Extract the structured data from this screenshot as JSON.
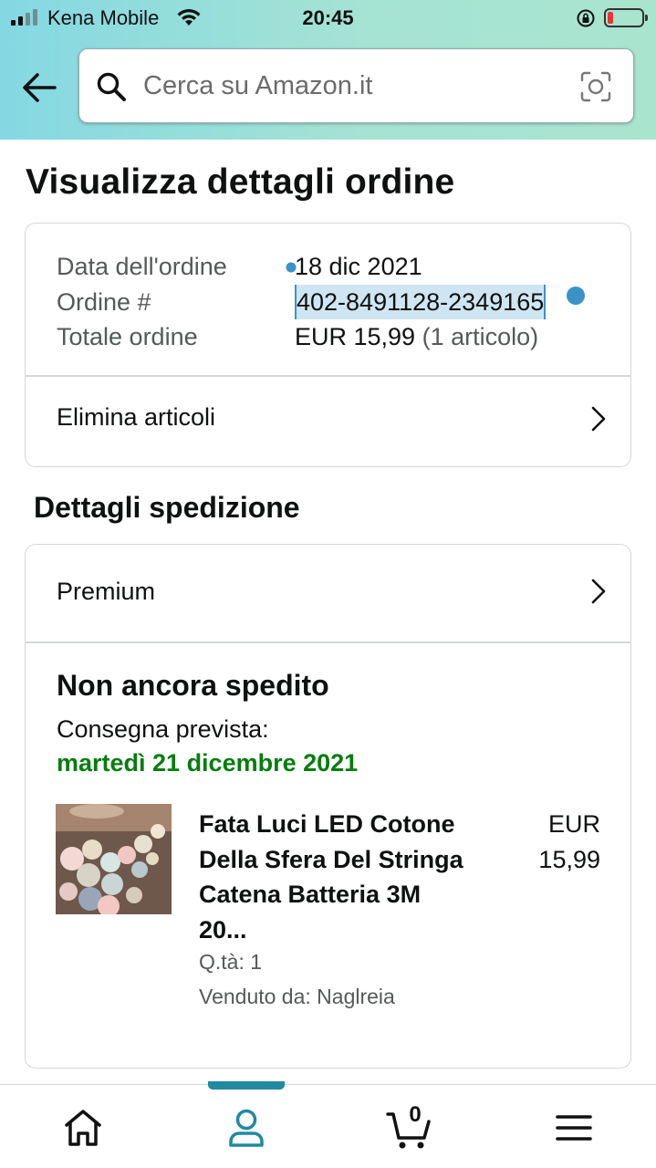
{
  "status_bar": {
    "carrier": "Kena Mobile",
    "time": "20:45",
    "battery_color": "#ee3333"
  },
  "header": {
    "back_icon": "arrow-left-icon",
    "search_placeholder": "Cerca su Amazon.it",
    "search_value": "",
    "camera_icon": "camera-scan-icon"
  },
  "page_title": "Visualizza dettagli ordine",
  "order": {
    "date_label": "Data dell'ordine",
    "date_value": "18 dic 2021",
    "number_label": "Ordine #",
    "number_value": "402-8491128-2349165",
    "total_label": "Totale ordine",
    "total_value": "EUR 15,99",
    "total_items": "(1 articolo)",
    "delete_items": "Elimina articoli"
  },
  "shipping": {
    "section_title": "Dettagli spedizione",
    "method": "Premium",
    "status": "Non ancora spedito",
    "delivery_label": "Consegna prevista:",
    "delivery_date": "martedì 21 dicembre 2021",
    "delivery_color": "#067d0e",
    "product": {
      "name": "Fata Luci LED Cotone Della Sfera Del Stringa Catena Batteria 3M 20...",
      "price_currency": "EUR",
      "price_amount": "15,99",
      "quantity": "Q.tà: 1",
      "seller": "Venduto da: Naglreia"
    }
  },
  "bottom_nav": {
    "items": [
      "home-icon",
      "account-icon",
      "cart-icon",
      "menu-icon"
    ],
    "active": "account-icon",
    "cart_count": "0",
    "accent_color": "#1f8aa0"
  }
}
